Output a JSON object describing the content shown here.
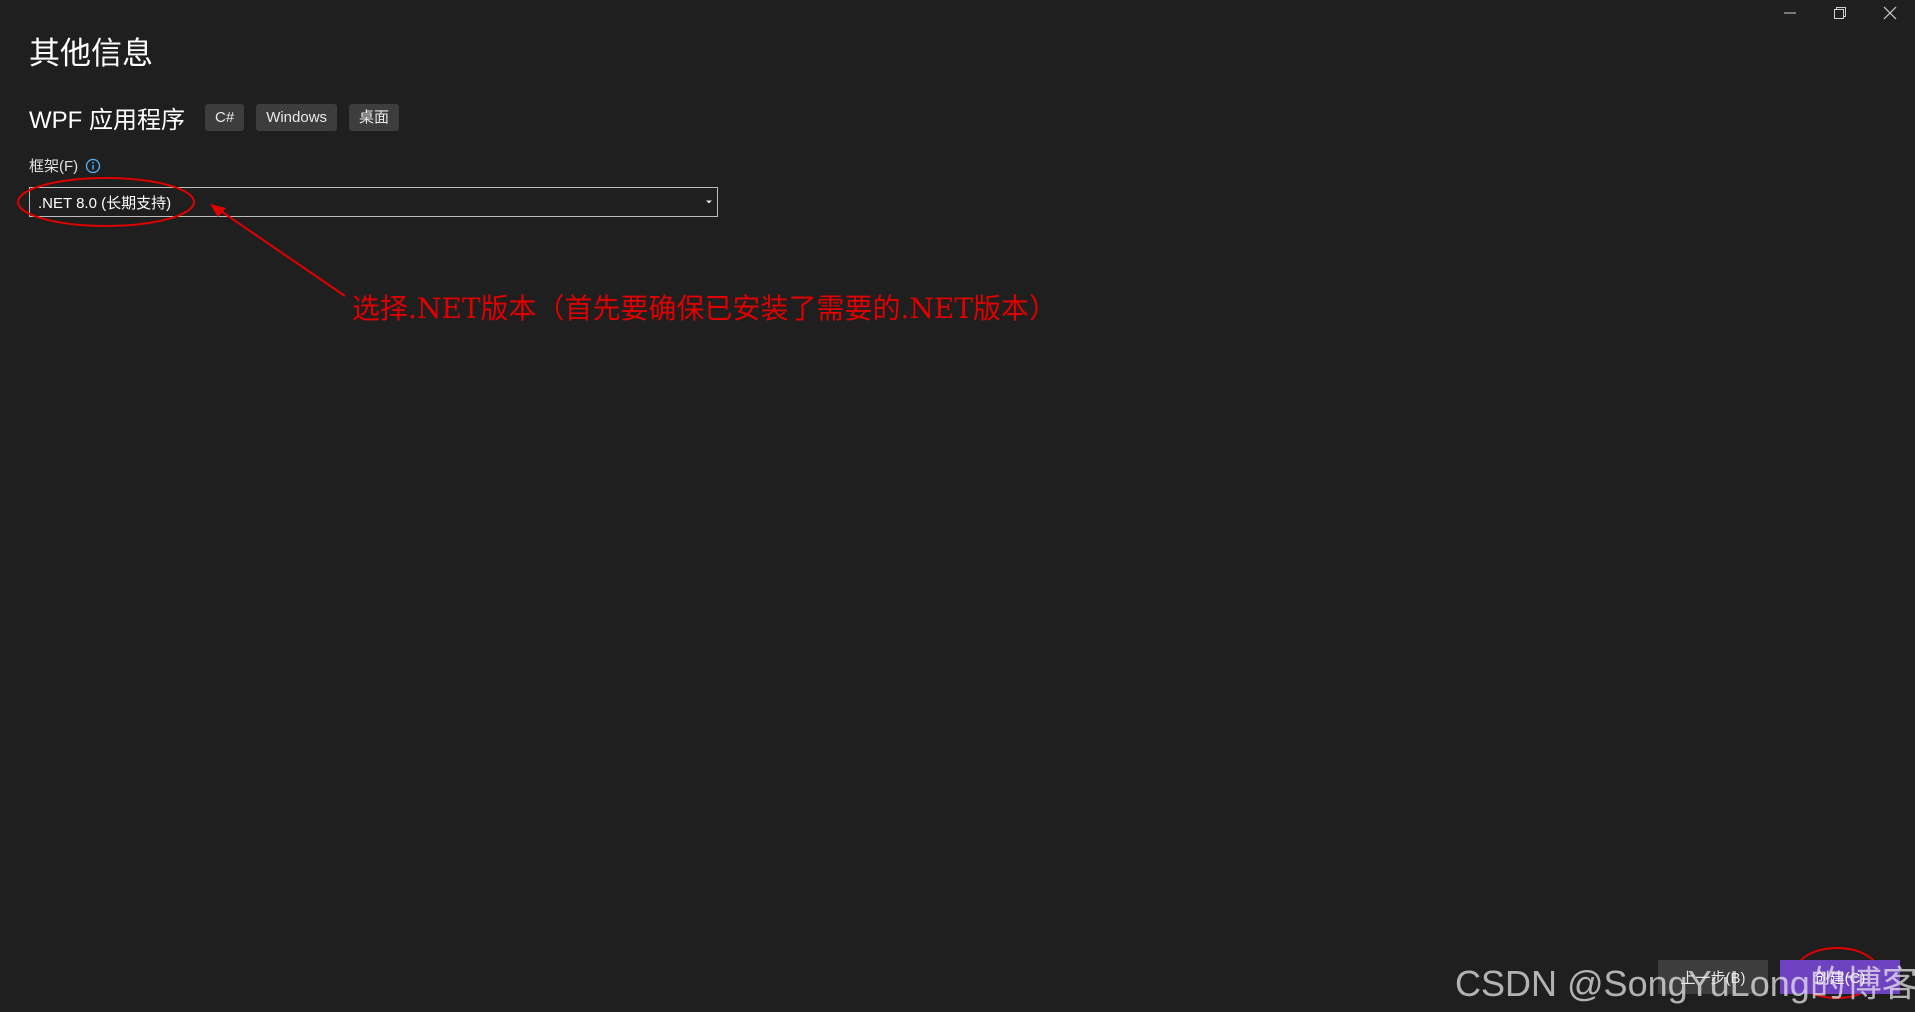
{
  "window": {
    "minimize_icon": "minimize-icon",
    "restore_icon": "restore-icon",
    "close_icon": "close-icon"
  },
  "page": {
    "title": "其他信息"
  },
  "project": {
    "name": "WPF 应用程序",
    "tags": [
      "C#",
      "Windows",
      "桌面"
    ]
  },
  "framework": {
    "label": "框架(F)",
    "info_icon": "info-icon",
    "selected": ".NET 8.0 (长期支持)"
  },
  "annotation": {
    "text": "选择.NET版本（首先要确保已安装了需要的.NET版本）",
    "color": "#e00000"
  },
  "footer": {
    "back_label": "上一步(B)",
    "create_label": "创建(C)"
  },
  "watermark": "CSDN @SongYuLong的博客",
  "colors": {
    "background": "#1f1f1f",
    "accent": "#6f42c1",
    "tag_bg": "#3d3d3d"
  }
}
